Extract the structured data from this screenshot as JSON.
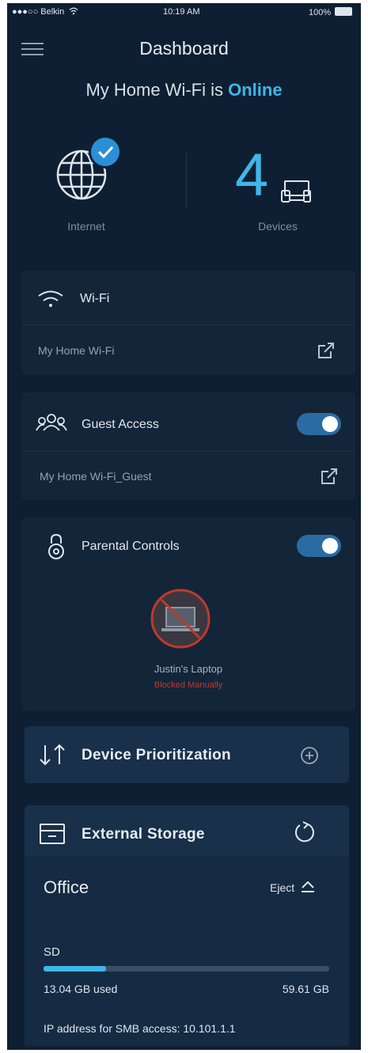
{
  "status_bar": {
    "carrier": "●●●○○ Belkin",
    "time": "10:19 AM",
    "battery": "100%"
  },
  "header": {
    "title": "Dashboard",
    "menu_icon": "hamburger-menu-icon"
  },
  "network_status": {
    "prefix": "My Home Wi-Fi is",
    "state": "Online",
    "state_color": "#3fb6e8"
  },
  "summary": {
    "internet": {
      "label": "Internet",
      "icon": "globe-icon",
      "badge_icon": "checkmark-icon"
    },
    "devices": {
      "count": "4",
      "label": "Devices",
      "icon": "devices-icon"
    }
  },
  "wifi": {
    "title": "Wi-Fi",
    "network_name": "My Home Wi-Fi",
    "icon": "wifi-icon",
    "share_icon": "share-icon"
  },
  "guest_access": {
    "title": "Guest Access",
    "network_name": "My Home Wi-Fi_Guest",
    "enabled": true,
    "icon": "guests-icon",
    "share_icon": "share-icon"
  },
  "parental_controls": {
    "title": "Parental Controls",
    "enabled": true,
    "icon": "lock-icon",
    "device": {
      "name": "Justin's Laptop",
      "status": "Blocked Manually",
      "status_color": "#c0392b",
      "icon": "blocked-laptop-icon"
    }
  },
  "device_prioritization": {
    "title": "Device Prioritization",
    "icon": "sort-arrows-icon",
    "add_icon": "add-circle-icon"
  },
  "external_storage": {
    "title": "External Storage",
    "icon": "storage-drive-icon",
    "refresh_icon": "refresh-icon",
    "drive": {
      "name": "Office",
      "eject_label": "Eject",
      "eject_icon": "eject-icon",
      "partition": "SD",
      "used": "13.04 GB used",
      "total": "59.61 GB",
      "usage_fraction": 0.219,
      "ip_text": "IP address for SMB access: 10.101.1.1"
    }
  }
}
